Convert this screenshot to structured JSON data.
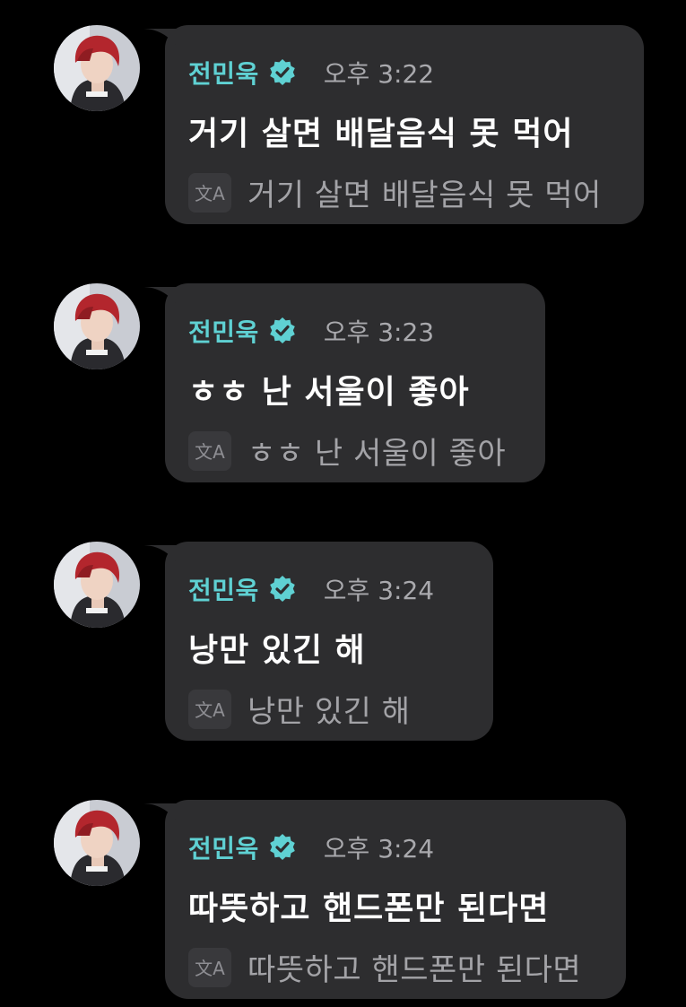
{
  "colors": {
    "background": "#000000",
    "bubble": "#2d2d2f",
    "name": "#5fd1d3",
    "verified_badge": "#5fd1d3",
    "time": "#a9a9ad",
    "message_text": "#ffffff",
    "translation_text": "#a3a3a7"
  },
  "icons": {
    "verified": "verified-badge-icon",
    "translate": "translate-icon",
    "avatar": "profile-avatar"
  },
  "messages": [
    {
      "sender": "전민욱",
      "time": "오후 3:22",
      "text": "거기 살면 배달음식 못 먹어",
      "translation": "거기 살면 배달음식 못 먹어"
    },
    {
      "sender": "전민욱",
      "time": "오후 3:23",
      "text": "ㅎㅎ 난 서울이 좋아",
      "translation": "ㅎㅎ 난 서울이 좋아"
    },
    {
      "sender": "전민욱",
      "time": "오후 3:24",
      "text": "낭만 있긴 해",
      "translation": "낭만 있긴 해"
    },
    {
      "sender": "전민욱",
      "time": "오후 3:24",
      "text": "따뜻하고 핸드폰만 된다면",
      "translation": "따뜻하고 핸드폰만 된다면"
    }
  ]
}
